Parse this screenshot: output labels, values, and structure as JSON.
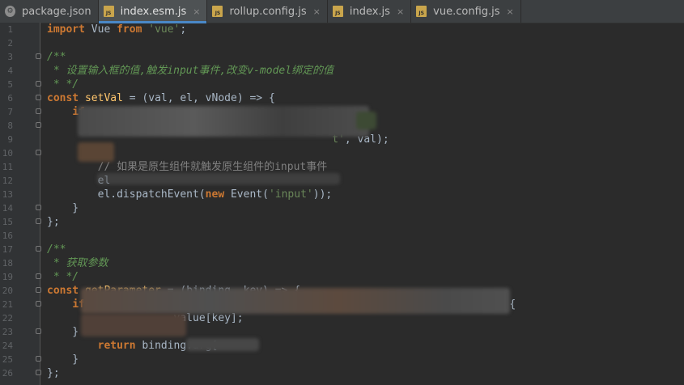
{
  "tabs": [
    {
      "label": "package.json",
      "icon": "package-json-icon",
      "active": false,
      "closable": false
    },
    {
      "label": "index.esm.js",
      "icon": "js-file-icon",
      "active": true,
      "closable": true
    },
    {
      "label": "rollup.config.js",
      "icon": "js-file-icon",
      "active": false,
      "closable": true
    },
    {
      "label": "index.js",
      "icon": "js-file-icon",
      "active": false,
      "closable": true
    },
    {
      "label": "vue.config.js",
      "icon": "js-file-icon",
      "active": false,
      "closable": true
    }
  ],
  "file_icon_text": "JS",
  "close_glyph": "×",
  "colors": {
    "background": "#2b2b2b",
    "keyword": "#cc7832",
    "string": "#6a8759",
    "doc_comment": "#629755",
    "comment": "#808080",
    "function": "#ffc66d",
    "text": "#a9b7c6",
    "active_tab_underline": "#4a88c7"
  },
  "lines": [
    {
      "n": "1",
      "fold": false,
      "html": "<span class='kw'>import</span> Vue <span class='kw'>from</span> <span class='str'>'vue'</span>;"
    },
    {
      "n": "2",
      "fold": false,
      "html": ""
    },
    {
      "n": "3",
      "fold": true,
      "html": "<span class='cmt'>/**</span>"
    },
    {
      "n": "4",
      "fold": false,
      "html": "<span class='cmt'> * 设置输入框的值,触发input事件,改变v-model绑定的值</span>"
    },
    {
      "n": "5",
      "fold": true,
      "html": "<span class='cmt'> * */</span>"
    },
    {
      "n": "6",
      "fold": true,
      "html": "<span class='kw'>const</span> <span class='fn'>setVal</span> = (val, el, vNode) => {"
    },
    {
      "n": "7",
      "fold": true,
      "html": "    <span class='kw'>if</span>"
    },
    {
      "n": "8",
      "fold": true,
      "html": ""
    },
    {
      "n": "9",
      "fold": false,
      "html": "                                             <span class='str'>t'</span>, val);"
    },
    {
      "n": "10",
      "fold": true,
      "html": ""
    },
    {
      "n": "11",
      "fold": false,
      "html": "        <span class='cmtpl'>// 如果是原生组件就触发原生组件的input事件</span>"
    },
    {
      "n": "12",
      "fold": false,
      "html": "        el"
    },
    {
      "n": "13",
      "fold": false,
      "html": "        el.dispatchEvent(<span class='kw'>new</span> Event(<span class='str'>'input'</span>));"
    },
    {
      "n": "14",
      "fold": true,
      "html": "    }"
    },
    {
      "n": "15",
      "fold": true,
      "html": "};"
    },
    {
      "n": "16",
      "fold": false,
      "html": ""
    },
    {
      "n": "17",
      "fold": true,
      "html": "<span class='cmt'>/**</span>"
    },
    {
      "n": "18",
      "fold": false,
      "html": "<span class='cmt'> * 获取参数</span>"
    },
    {
      "n": "19",
      "fold": true,
      "html": "<span class='cmt'> * */</span>"
    },
    {
      "n": "20",
      "fold": true,
      "html": "<span class='kw'>const</span> <span class='fn'>getParameter</span> = (binding, key) => {"
    },
    {
      "n": "21",
      "fold": true,
      "html": "    <span class='kw'>if</span>                                                ] !== <span class='str'>'undefined'</span>) {"
    },
    {
      "n": "22",
      "fold": false,
      "html": "                   .value[key];"
    },
    {
      "n": "23",
      "fold": true,
      "html": "    }"
    },
    {
      "n": "24",
      "fold": false,
      "html": "        <span class='kw'>return</span> binding.arg["
    },
    {
      "n": "25",
      "fold": true,
      "html": "    }"
    },
    {
      "n": "26",
      "fold": true,
      "html": "};"
    }
  ]
}
